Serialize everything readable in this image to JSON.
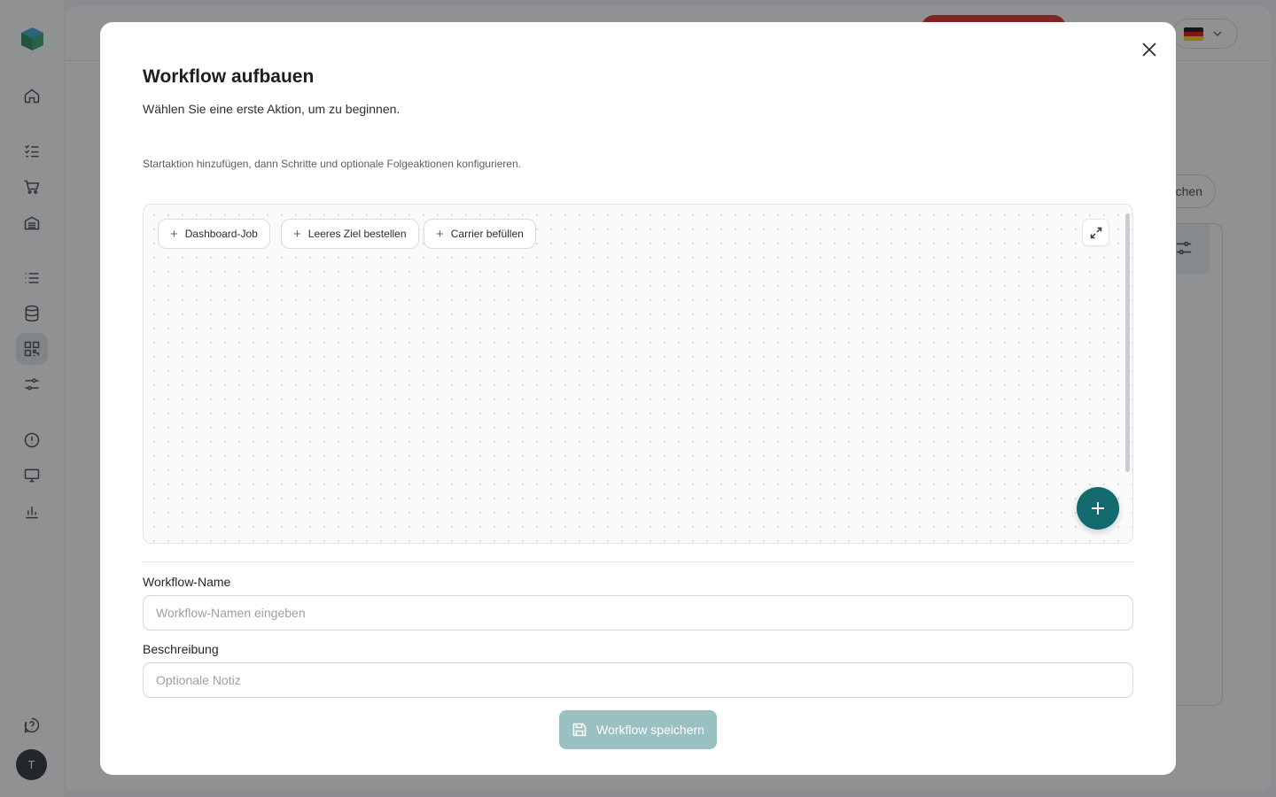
{
  "app": {
    "sidebar_icons": [
      "home-icon",
      "checklist-icon",
      "cart-icon",
      "warehouse-icon",
      "list-icon",
      "database-icon",
      "qr-code-icon",
      "sliders-icon",
      "alert-icon",
      "monitor-icon",
      "bar-chart-icon",
      "help-icon"
    ],
    "active_icon": "qr-code-icon",
    "avatar_initial": "T",
    "background_button_label": "chen",
    "language_flag": "de"
  },
  "modal": {
    "title": "Workflow aufbauen",
    "subtitle": "Wählen Sie eine erste Aktion, um zu beginnen.",
    "hint": "Startaktion hinzufügen, dann Schritte und optionale Folgeaktionen konfigurieren.",
    "start_actions": [
      {
        "label": "Dashboard-Job"
      },
      {
        "label": "Leeres Ziel bestellen"
      },
      {
        "label": "Carrier befüllen"
      }
    ],
    "name_field": {
      "label": "Workflow-Name",
      "placeholder": "Workflow-Namen eingeben",
      "value": ""
    },
    "description_field": {
      "label": "Beschreibung",
      "placeholder": "Optionale Notiz",
      "value": ""
    },
    "save_label": "Workflow speichern"
  },
  "colors": {
    "accent": "#126a6e",
    "save_disabled": "#9ac0c2",
    "alert_red": "#e11d1d"
  }
}
